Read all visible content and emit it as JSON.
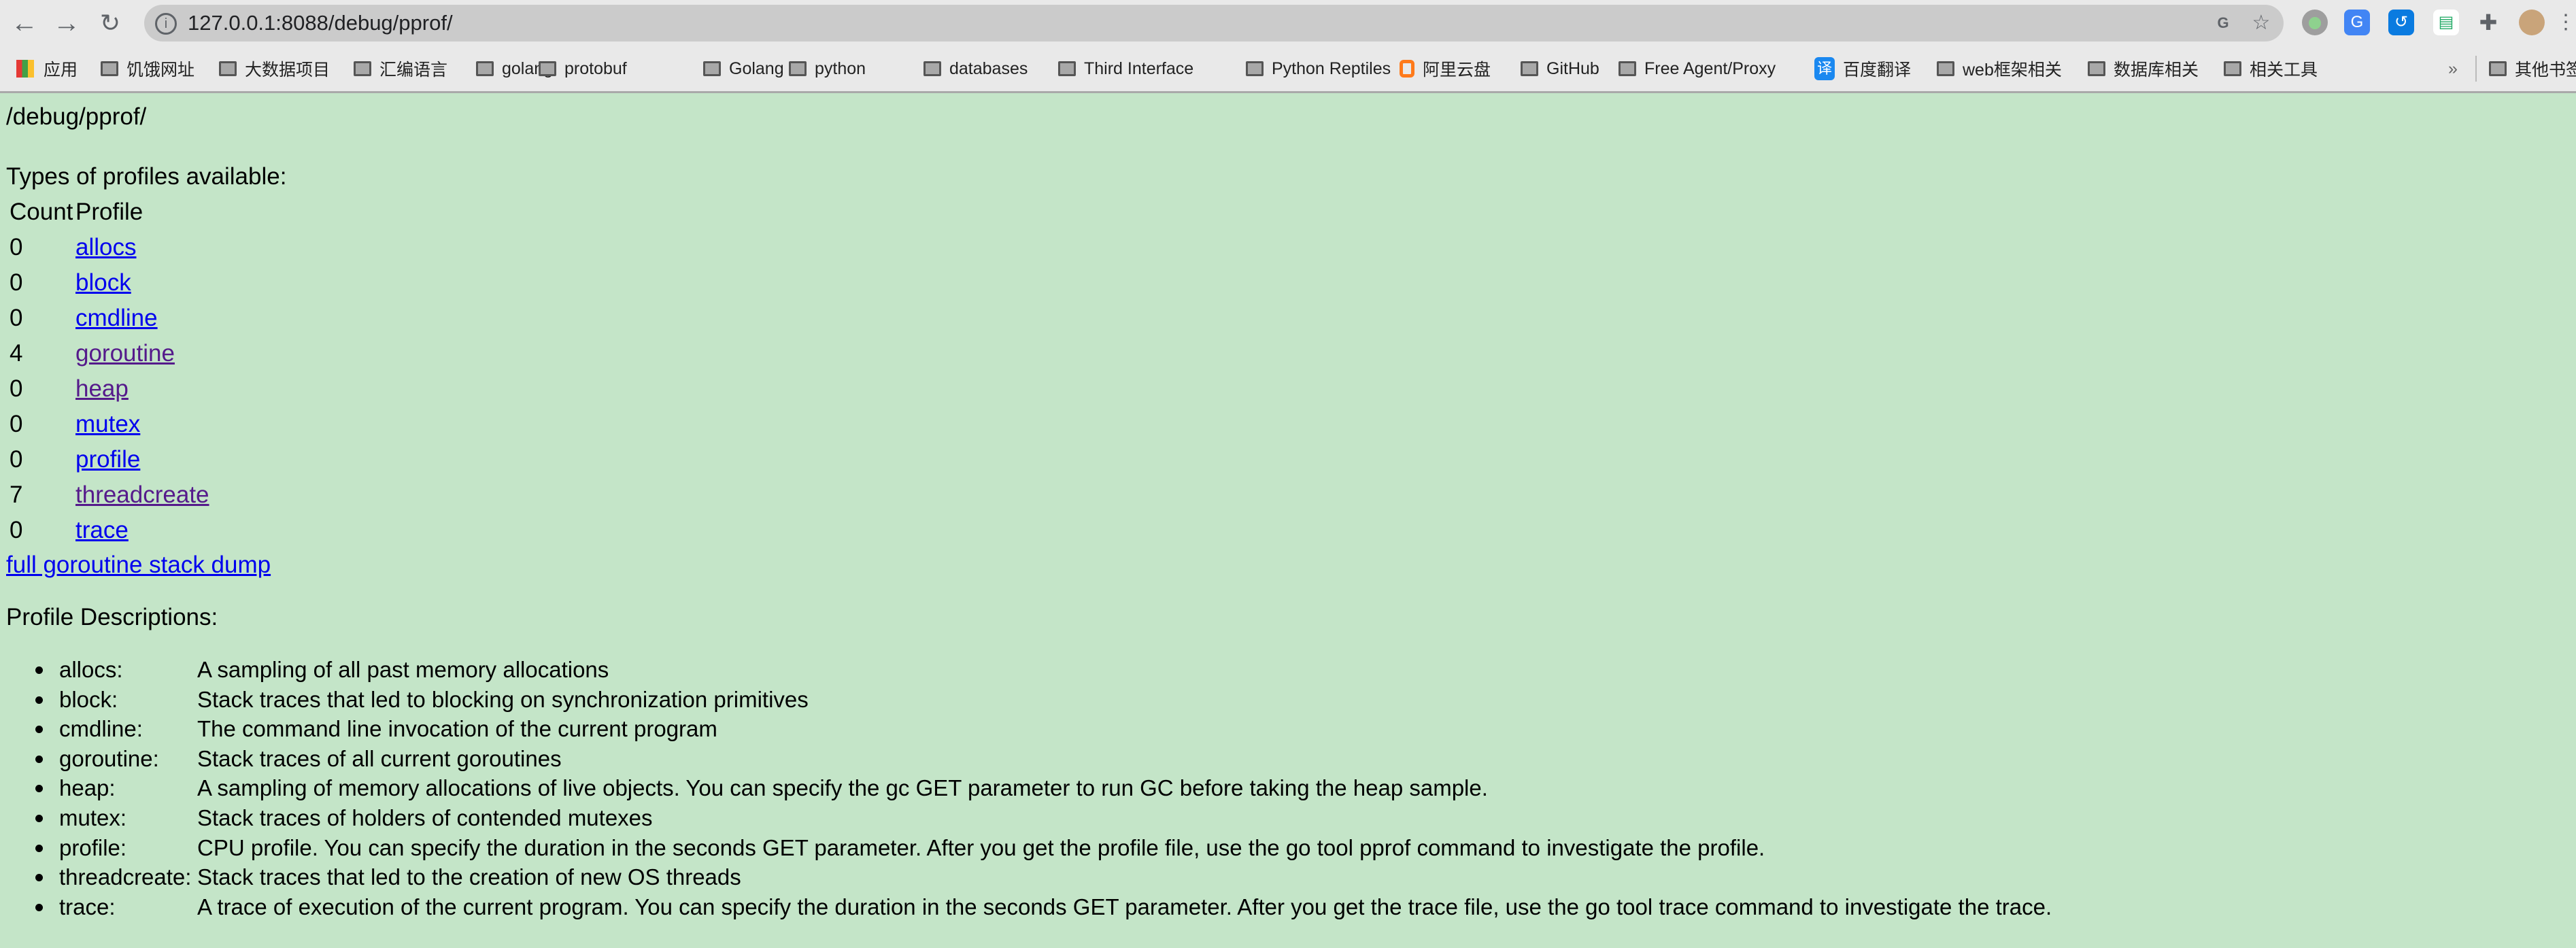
{
  "browser": {
    "url": "127.0.0.1:8088/debug/pprof/",
    "nav": {
      "back_icon": "arrow-left-icon",
      "forward_icon": "arrow-right-icon",
      "reload_icon": "reload-icon"
    },
    "bookmarks": [
      {
        "label": "应用",
        "icon": "apps-grid-icon"
      },
      {
        "label": "饥饿网址",
        "icon": "folder-icon"
      },
      {
        "label": "大数据项目",
        "icon": "folder-icon"
      },
      {
        "label": "汇编语言",
        "icon": "folder-icon"
      },
      {
        "label": "golang",
        "icon": "folder-icon"
      },
      {
        "label": "protobuf",
        "icon": "folder-icon"
      },
      {
        "label": "Golang",
        "icon": "folder-icon"
      },
      {
        "label": "python",
        "icon": "folder-icon"
      },
      {
        "label": "databases",
        "icon": "folder-icon"
      },
      {
        "label": "Third Interface",
        "icon": "folder-icon"
      },
      {
        "label": "Python Reptiles",
        "icon": "folder-icon"
      },
      {
        "label": "阿里云盘",
        "icon": "aliyun-icon"
      },
      {
        "label": "GitHub",
        "icon": "folder-icon"
      },
      {
        "label": "Free Agent/Proxy",
        "icon": "folder-icon"
      },
      {
        "label": "百度翻译",
        "icon": "baidu-translate-icon"
      },
      {
        "label": "web框架相关",
        "icon": "folder-icon"
      },
      {
        "label": "数据库相关",
        "icon": "folder-icon"
      },
      {
        "label": "相关工具",
        "icon": "folder-icon"
      }
    ],
    "overflow": "»",
    "other_bookmarks": "其他书签",
    "baidu_icon_char": "译"
  },
  "page": {
    "title": "/debug/pprof/",
    "types_heading": "Types of profiles available:",
    "table": {
      "headers": [
        "Count",
        "Profile"
      ],
      "rows": [
        {
          "count": "0",
          "profile": "allocs",
          "visited": false
        },
        {
          "count": "0",
          "profile": "block",
          "visited": false
        },
        {
          "count": "0",
          "profile": "cmdline",
          "visited": false
        },
        {
          "count": "4",
          "profile": "goroutine",
          "visited": true
        },
        {
          "count": "0",
          "profile": "heap",
          "visited": true
        },
        {
          "count": "0",
          "profile": "mutex",
          "visited": false
        },
        {
          "count": "0",
          "profile": "profile",
          "visited": false
        },
        {
          "count": "7",
          "profile": "threadcreate",
          "visited": true
        },
        {
          "count": "0",
          "profile": "trace",
          "visited": false
        }
      ]
    },
    "full_dump_link": "full goroutine stack dump",
    "descriptions_heading": "Profile Descriptions:",
    "descriptions": [
      {
        "name": "allocs:",
        "text": "A sampling of all past memory allocations"
      },
      {
        "name": "block:",
        "text": "Stack traces that led to blocking on synchronization primitives"
      },
      {
        "name": "cmdline:",
        "text": "The command line invocation of the current program"
      },
      {
        "name": "goroutine:",
        "text": "Stack traces of all current goroutines"
      },
      {
        "name": "heap:",
        "text": "A sampling of memory allocations of live objects. You can specify the gc GET parameter to run GC before taking the heap sample."
      },
      {
        "name": "mutex:",
        "text": "Stack traces of holders of contended mutexes"
      },
      {
        "name": "profile:",
        "text": "CPU profile. You can specify the duration in the seconds GET parameter. After you get the profile file, use the go tool pprof command to investigate the profile."
      },
      {
        "name": "threadcreate:",
        "text": "Stack traces that led to the creation of new OS threads"
      },
      {
        "name": "trace:",
        "text": "A trace of execution of the current program. You can specify the duration in the seconds GET parameter. After you get the trace file, use the go tool trace command to investigate the trace."
      }
    ]
  },
  "colors": {
    "page_bg": "#c4e5c8",
    "link": "#0000ee",
    "visited_link": "#551a8b"
  }
}
